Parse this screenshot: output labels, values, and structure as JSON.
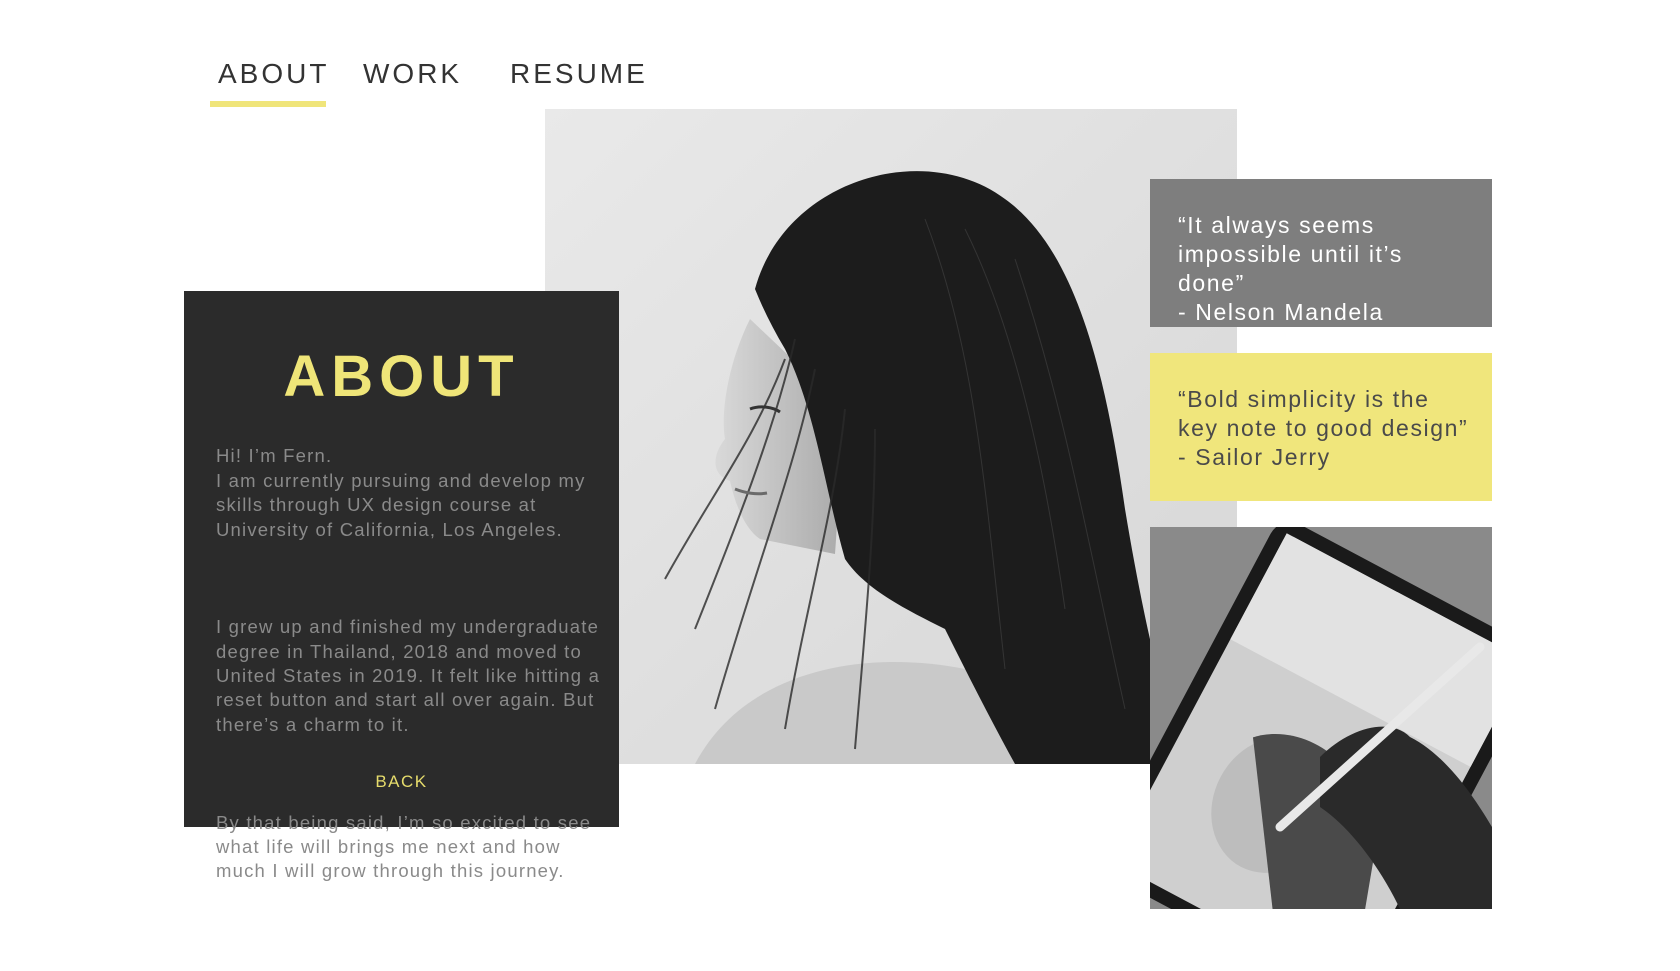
{
  "nav": {
    "items": [
      {
        "label": "ABOUT",
        "active": true
      },
      {
        "label": "WORK",
        "active": false
      },
      {
        "label": "RESUME",
        "active": false
      }
    ]
  },
  "about": {
    "title": "ABOUT",
    "paragraphs": [
      "Hi! I’m Fern.\nI am currently pursuing and develop my skills through UX design course at University of California, Los Angeles.",
      "I grew up and finished my undergraduate degree in Thailand, 2018 and moved to United States in 2019. It felt like hitting a reset button and start all over again. But there’s a charm to it.",
      "By that being said, I’m so excited to see what life will brings me next and how much I will grow through this journey."
    ],
    "back_label": "BACK"
  },
  "quotes": [
    {
      "text": "“It always seems impossible until it’s done”\n- Nelson Mandela"
    },
    {
      "text": "“Bold simplicity is the key note to good design”\n- Sailor Jerry"
    }
  ],
  "colors": {
    "accent_yellow": "#f0e67c",
    "card_dark": "#2b2b2b",
    "quote_grey": "#7e7e7e"
  }
}
